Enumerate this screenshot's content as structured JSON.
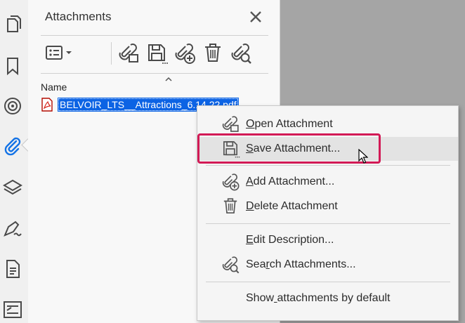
{
  "panel": {
    "title": "Attachments",
    "column_header": "Name",
    "file_name": "BELVOIR_LTS__Attractions_6.14.22.pdf"
  },
  "nav_icons": [
    "pages-icon",
    "bookmark-icon",
    "layers-target-icon",
    "paperclip-icon",
    "stack-layers-icon",
    "signature-icon",
    "document-icon",
    "compare-icon"
  ],
  "toolbar_icons": [
    "options-dropdown-icon",
    "open-attachment-icon",
    "save-attachment-icon",
    "add-attachment-icon",
    "delete-icon",
    "search-attachments-icon"
  ],
  "context_menu": {
    "items": [
      {
        "label": "Open Attachment",
        "mnemonic_index": 0,
        "icon": "open-attachment-icon"
      },
      {
        "label": "Save Attachment...",
        "mnemonic_index": 0,
        "icon": "save-attachment-icon"
      },
      {
        "label": "Add Attachment...",
        "mnemonic_index": 0,
        "icon": "add-attachment-icon"
      },
      {
        "label": "Delete Attachment",
        "mnemonic_index": 0,
        "icon": "delete-icon"
      },
      {
        "label": "Edit Description...",
        "mnemonic_index": 0,
        "icon": ""
      },
      {
        "label": "Search Attachments...",
        "mnemonic_index": 3,
        "icon": "search-attachments-icon"
      },
      {
        "label": "Show attachments by default",
        "mnemonic_index": 4,
        "icon": ""
      }
    ],
    "hovered_item": "Save Attachment..."
  },
  "colors": {
    "selection": "#0c63e4",
    "highlight": "#d21a56",
    "icon": "#4a4a4a",
    "accent_blue": "#1473e6"
  }
}
